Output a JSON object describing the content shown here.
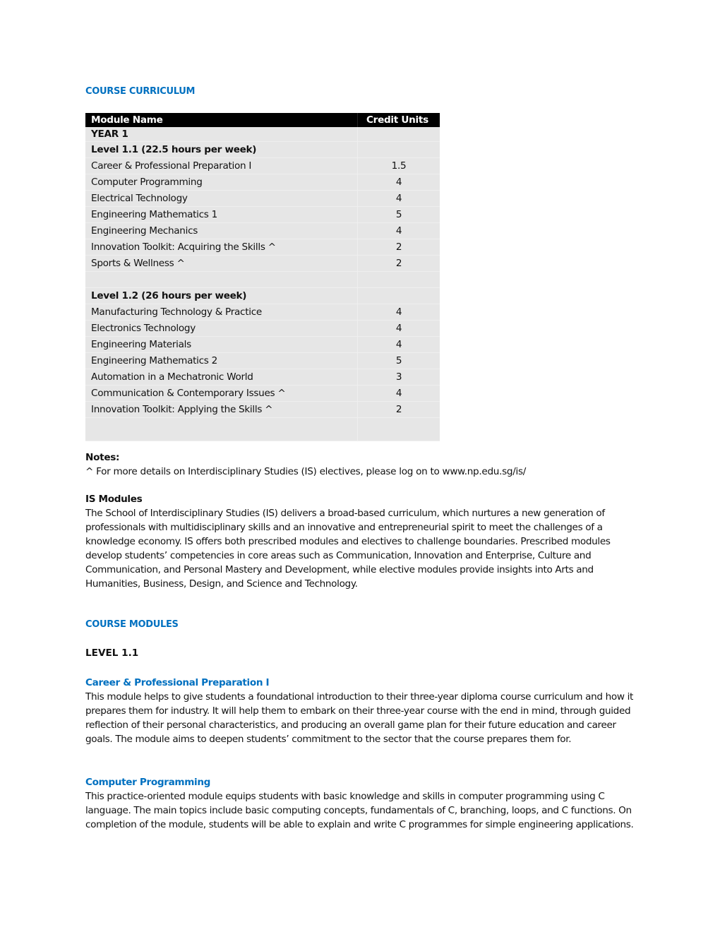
{
  "headings": {
    "course_curriculum": "COURSE CURRICULUM",
    "course_modules": "COURSE MODULES",
    "level_1_1": "LEVEL 1.1"
  },
  "table": {
    "columns": [
      "Module Name",
      "Credit Units"
    ],
    "year": "YEAR 1",
    "level_1_1": {
      "title": "Level 1.1 (22.5 hours per week)",
      "rows": [
        {
          "name": "Career & Professional Preparation I",
          "credits": "1.5"
        },
        {
          "name": "Computer Programming",
          "credits": "4"
        },
        {
          "name": "Electrical Technology",
          "credits": "4"
        },
        {
          "name": "Engineering Mathematics 1",
          "credits": "5"
        },
        {
          "name": "Engineering Mechanics",
          "credits": "4"
        },
        {
          "name": "Innovation Toolkit: Acquiring the Skills ^",
          "credits": "2"
        },
        {
          "name": "Sports & Wellness ^",
          "credits": "2"
        }
      ]
    },
    "level_1_2": {
      "title": "Level 1.2 (26 hours per week)",
      "rows": [
        {
          "name": "Manufacturing Technology & Practice",
          "credits": "4"
        },
        {
          "name": "Electronics Technology",
          "credits": "4"
        },
        {
          "name": "Engineering Materials",
          "credits": "4"
        },
        {
          "name": "Engineering Mathematics 2",
          "credits": "5"
        },
        {
          "name": "Automation in a Mechatronic World",
          "credits": "3"
        },
        {
          "name": "Communication & Contemporary Issues ^",
          "credits": "4"
        },
        {
          "name": "Innovation Toolkit: Applying the Skills ^",
          "credits": "2"
        }
      ]
    }
  },
  "notes": {
    "label": "Notes:",
    "text": "^ For more details on Interdisciplinary Studies (IS) electives, please log on to www.np.edu.sg/is/"
  },
  "is_modules": {
    "title": "IS Modules",
    "text": "The School of Interdisciplinary Studies (IS) delivers a broad-based curriculum, which nurtures a new generation of professionals with multidisciplinary skills and an innovative and entrepreneurial spirit to meet the challenges of a knowledge economy. IS offers both prescribed modules and electives to challenge boundaries. Prescribed modules develop students’ competencies in core areas such as Communication, Innovation and Enterprise, Culture and Communication, and Personal Mastery and Development, while elective modules provide insights into Arts and Humanities, Business, Design, and Science and Technology."
  },
  "modules": [
    {
      "title": "Career & Professional Preparation I",
      "text": "This module helps to give students a foundational introduction to their three-year diploma course curriculum and how it prepares them for industry. It will help them to embark on their three-year course with the end in mind, through guided reflection of their personal characteristics, and producing an overall game plan for their future education and career goals. The module aims to deepen students’ commitment to the sector that the course prepares them for."
    },
    {
      "title": "Computer Programming",
      "text": "This practice-oriented module equips students with basic knowledge and skills in computer programming using C language. The main topics include basic computing concepts, fundamentals of C, branching, loops, and C functions. On completion of the module, students will be able to explain and write C programmes for simple engineering applications."
    }
  ]
}
